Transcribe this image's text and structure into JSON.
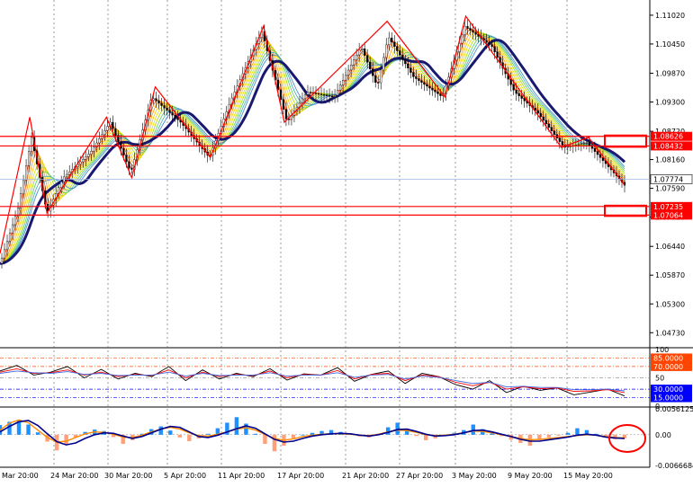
{
  "colors": {
    "background": "#ffffff",
    "grid": "#c8c8c8",
    "line_red": "#ff0000",
    "ma_navy": "#191970",
    "price_line": "#9fb6e6",
    "candle": "#000000",
    "rsi_black": "#000000",
    "rsi_red": "#ff0000",
    "rsi_blue": "#4169e1",
    "macd_hist_pos": "#1e90ff",
    "macd_hist_neg": "#ffa07a",
    "macd_signal": "#ff8c00",
    "macd_line": "#00008b",
    "level_blue": "#0000ff",
    "level_red": "#ff4500"
  },
  "chart_data": [
    {
      "type": "candlestick",
      "panel": "price",
      "y_ticks": [
        "1.11020",
        "1.10450",
        "1.09870",
        "1.09300",
        "1.08720",
        "1.08160",
        "1.07590",
        "1.07020",
        "1.06440",
        "1.05870",
        "1.05300",
        "1.04730"
      ],
      "ylim": [
        1.0445,
        1.1125
      ],
      "x_labels": [
        "Mar 20:00",
        "24 Mar 20:00",
        "30 Mar 20:00",
        "5 Apr 20:00",
        "11 Apr 20:00",
        "17 Apr 20:00",
        "21 Apr 20:00",
        "27 Apr 20:00",
        "3 May 20:00",
        "9 May 20:00",
        "15 May 20:00"
      ],
      "x_range": [
        0,
        690
      ],
      "price_path": [
        [
          0,
          1.061
        ],
        [
          20,
          1.072
        ],
        [
          35,
          1.086
        ],
        [
          52,
          1.071
        ],
        [
          70,
          1.078
        ],
        [
          100,
          1.083
        ],
        [
          122,
          1.089
        ],
        [
          145,
          1.079
        ],
        [
          168,
          1.094
        ],
        [
          200,
          1.089
        ],
        [
          232,
          1.082
        ],
        [
          255,
          1.093
        ],
        [
          290,
          1.107
        ],
        [
          318,
          1.089
        ],
        [
          340,
          1.095
        ],
        [
          370,
          1.094
        ],
        [
          400,
          1.104
        ],
        [
          418,
          1.096
        ],
        [
          430,
          1.106
        ],
        [
          458,
          1.098
        ],
        [
          490,
          1.094
        ],
        [
          515,
          1.108
        ],
        [
          545,
          1.104
        ],
        [
          570,
          1.095
        ],
        [
          595,
          1.091
        ],
        [
          625,
          1.084
        ],
        [
          650,
          1.085
        ],
        [
          670,
          1.081
        ],
        [
          692,
          1.0765
        ]
      ],
      "zigzag": [
        [
          0,
          1.063
        ],
        [
          33,
          1.09
        ],
        [
          52,
          1.071
        ],
        [
          118,
          1.09
        ],
        [
          146,
          1.078
        ],
        [
          172,
          1.096
        ],
        [
          233,
          1.082
        ],
        [
          292,
          1.108
        ],
        [
          315,
          1.089
        ],
        [
          429,
          1.109
        ],
        [
          493,
          1.094
        ],
        [
          516,
          1.11
        ],
        [
          622,
          1.084
        ],
        [
          652,
          1.086
        ],
        [
          692,
          1.0765
        ]
      ],
      "h_lines": [
        {
          "value": 1.0862,
          "label": "1.08626"
        },
        {
          "value": 1.0843,
          "label": "1.08432"
        },
        {
          "value": 1.0723,
          "label": "1.07235"
        },
        {
          "value": 1.0706,
          "label": "1.07064"
        }
      ],
      "current_price": {
        "value": 1.0777,
        "label": "1.07774"
      }
    },
    {
      "type": "line",
      "panel": "rsi",
      "y_ticks": [
        "100",
        "85.0000",
        "70.0000",
        "50",
        "30.0000",
        "15.0000",
        "0"
      ],
      "levels": [
        85,
        70,
        50,
        30,
        15
      ],
      "ylim": [
        0,
        100
      ],
      "series": [
        {
          "color_key": "rsi_black",
          "values": [
            62,
            72,
            55,
            60,
            70,
            50,
            65,
            48,
            58,
            52,
            70,
            45,
            64,
            48,
            58,
            52,
            66,
            46,
            57,
            55,
            68,
            44,
            56,
            62,
            40,
            58,
            52,
            38,
            30,
            45,
            24,
            35,
            28,
            32,
            20,
            25,
            30,
            18
          ]
        },
        {
          "color_key": "rsi_red",
          "values": [
            60,
            66,
            58,
            59,
            64,
            55,
            60,
            52,
            56,
            54,
            64,
            50,
            60,
            52,
            56,
            54,
            62,
            50,
            56,
            55,
            63,
            48,
            56,
            58,
            45,
            55,
            52,
            42,
            36,
            42,
            30,
            34,
            31,
            32,
            26,
            27,
            29,
            24
          ]
        },
        {
          "color_key": "rsi_blue",
          "values": [
            58,
            62,
            59,
            58,
            61,
            56,
            58,
            54,
            55,
            55,
            60,
            53,
            58,
            54,
            55,
            55,
            59,
            53,
            55,
            55,
            59,
            51,
            55,
            56,
            48,
            53,
            51,
            45,
            40,
            42,
            34,
            35,
            33,
            33,
            29,
            29,
            30,
            27
          ]
        }
      ]
    },
    {
      "type": "bar",
      "panel": "macd",
      "y_ticks": [
        "0.0056125",
        "0.00",
        "-0.0066684"
      ],
      "ylim": [
        -0.0066684,
        0.0056125
      ],
      "histogram": [
        2.1,
        2.8,
        3.0,
        2.2,
        0.5,
        -1.5,
        -3.4,
        -2.2,
        -0.6,
        0.6,
        1.1,
        0.8,
        -0.5,
        -2.0,
        -1.2,
        0.2,
        1.2,
        1.8,
        0.9,
        -0.6,
        -1.4,
        -0.8,
        0.2,
        1.4,
        2.6,
        3.8,
        2.4,
        0.2,
        -2.0,
        -3.6,
        -2.4,
        -0.8,
        0.0,
        0.4,
        0.8,
        1.0,
        0.6,
        0.3,
        -0.4,
        -0.6,
        0.2,
        1.6,
        2.6,
        1.2,
        -0.3,
        -1.2,
        -0.8,
        0.0,
        0.4,
        1.0,
        2.2,
        1.2,
        0.3,
        -0.3,
        -1.1,
        -1.8,
        -2.4,
        -1.2,
        -0.6,
        -0.2,
        0.4,
        1.4,
        1.0,
        0.2,
        -0.6,
        -1.0,
        -0.8
      ],
      "signal": [
        1.0,
        2.5,
        3.2,
        2.6,
        1.0,
        -0.6,
        -1.6,
        -1.4,
        -0.6,
        0.2,
        0.6,
        0.5,
        0.1,
        -0.5,
        -0.6,
        -0.1,
        0.6,
        1.2,
        1.6,
        1.2,
        0.4,
        -0.2,
        -0.3,
        0.1,
        0.6,
        1.2,
        1.5,
        1.0,
        0.1,
        -0.8,
        -1.2,
        -0.9,
        -0.4,
        -0.1,
        0.1,
        0.2,
        0.2,
        0.1,
        -0.1,
        -0.2,
        0.1,
        0.6,
        1.0,
        0.9,
        0.5,
        0.0,
        -0.2,
        -0.1,
        0.1,
        0.4,
        0.8,
        0.7,
        0.4,
        0.0,
        -0.4,
        -0.8,
        -1.1,
        -1.0,
        -0.8,
        -0.6,
        -0.4,
        -0.2,
        0.0,
        -0.1,
        -0.4,
        -0.6,
        -0.7
      ],
      "macd": [
        0.6,
        1.8,
        2.8,
        3.1,
        2.0,
        0.2,
        -1.5,
        -2.2,
        -1.8,
        -0.8,
        0.0,
        0.4,
        0.3,
        -0.3,
        -0.8,
        -0.4,
        0.4,
        1.2,
        1.8,
        1.6,
        0.6,
        -0.4,
        -0.6,
        -0.1,
        0.6,
        1.3,
        1.9,
        1.4,
        0.2,
        -1.0,
        -1.6,
        -1.4,
        -0.8,
        -0.3,
        0.0,
        0.2,
        0.3,
        0.2,
        -0.1,
        -0.3,
        0.0,
        0.5,
        1.1,
        1.2,
        0.7,
        0.1,
        -0.3,
        -0.2,
        0.0,
        0.4,
        0.9,
        1.0,
        0.6,
        0.1,
        -0.4,
        -1.0,
        -1.4,
        -1.4,
        -1.1,
        -0.8,
        -0.5,
        -0.1,
        0.1,
        -0.1,
        -0.5,
        -0.7,
        -0.8
      ]
    }
  ]
}
